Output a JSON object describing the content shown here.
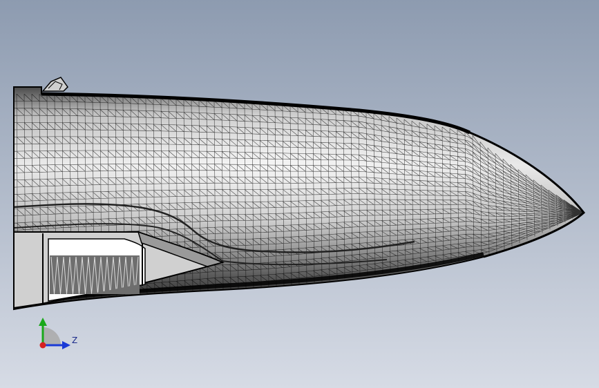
{
  "viewport": {
    "background_top": "#8d9bb0",
    "background_bottom": "#d6dbe5",
    "model": "nose-fuselage-mesh",
    "display_mode": "wireframe-shaded"
  },
  "triad": {
    "z_label": "Z",
    "colors": {
      "y_axis": "#1aa81a",
      "z_axis": "#1a3ad6",
      "x_axis": "#d62020"
    }
  }
}
